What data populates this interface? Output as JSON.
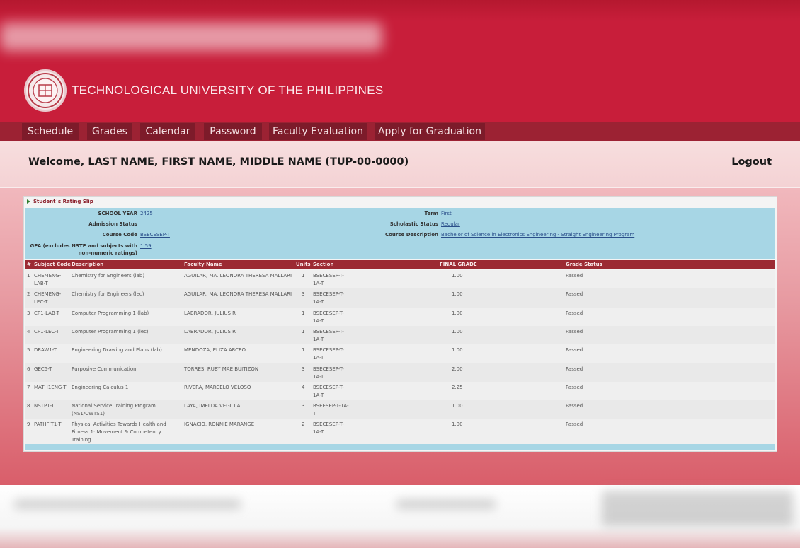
{
  "header": {
    "university_name": "TECHNOLOGICAL UNIVERSITY OF THE PHILIPPINES",
    "logo_icon": "university-seal-icon"
  },
  "nav": {
    "items": [
      "Schedule",
      "Grades",
      "Calendar",
      "Password",
      "Faculty Evaluation",
      "Apply for Graduation"
    ]
  },
  "welcome": {
    "text": "Welcome, LAST NAME, FIRST NAME, MIDDLE NAME (TUP-00-0000)",
    "logout": "Logout"
  },
  "rating_slip": {
    "title": "Student`s Rating Slip",
    "school_year_label": "SCHOOL YEAR",
    "school_year": "2425",
    "term_label": "Term",
    "term": "First",
    "admission_status_label": "Admission Status",
    "scholastic_status_label": "Scholastic Status",
    "scholastic_status": "Regular",
    "course_code_label": "Course Code",
    "course_code": "BSECESEP-T",
    "course_description_label": "Course Description",
    "course_description": "Bachelor of Science in Electronics Engineering - Straight Engineering Program",
    "gpa_label_1": "GPA (excludes NSTP and subjects with",
    "gpa_label_2": "non-numeric ratings)",
    "gpa": "1.59",
    "columns": [
      "#",
      "Subject Code",
      "Description",
      "Faculty Name",
      "Units",
      "Section",
      "FINAL GRADE",
      "Grade Status"
    ],
    "rows": [
      {
        "num": "1",
        "code": "CHEMENG-LAB-T",
        "desc": "Chemistry for Engineers (lab)",
        "faculty": "AGUILAR, MA. LEONORA THERESA MALLARI",
        "units": "1",
        "section": "BSECESEP-T-1A-T",
        "grade": "1.00",
        "status": "Passed"
      },
      {
        "num": "2",
        "code": "CHEMENG-LEC-T",
        "desc": "Chemistry for Engineers (lec)",
        "faculty": "AGUILAR, MA. LEONORA THERESA MALLARI",
        "units": "3",
        "section": "BSECESEP-T-1A-T",
        "grade": "1.00",
        "status": "Passed"
      },
      {
        "num": "3",
        "code": "CP1-LAB-T",
        "desc": "Computer Programming 1 (lab)",
        "faculty": "LABRADOR, JULIUS R",
        "units": "1",
        "section": "BSECESEP-T-1A-T",
        "grade": "1.00",
        "status": "Passed"
      },
      {
        "num": "4",
        "code": "CP1-LEC-T",
        "desc": "Computer Programming 1 (lec)",
        "faculty": "LABRADOR, JULIUS R",
        "units": "1",
        "section": "BSECESEP-T-1A-T",
        "grade": "1.00",
        "status": "Passed"
      },
      {
        "num": "5",
        "code": "DRAW1-T",
        "desc": "Engineering Drawing and Plans (lab)",
        "faculty": "MENDOZA, ELIZA ARCEO",
        "units": "1",
        "section": "BSECESEP-T-1A-T",
        "grade": "1.00",
        "status": "Passed"
      },
      {
        "num": "6",
        "code": "GEC5-T",
        "desc": "Purposive Communication",
        "faculty": "TORRES, RUBY MAE BUITIZON",
        "units": "3",
        "section": "BSECESEP-T-1A-T",
        "grade": "2.00",
        "status": "Passed"
      },
      {
        "num": "7",
        "code": "MATH1ENG-T",
        "desc": "Engineering Calculus 1",
        "faculty": "RIVERA, MARCELO VELOSO",
        "units": "4",
        "section": "BSECESEP-T-1A-T",
        "grade": "2.25",
        "status": "Passed"
      },
      {
        "num": "8",
        "code": "NSTP1-T",
        "desc": "National Service Training Program 1 (NS1/CWTS1)",
        "faculty": "LAYA, IMELDA VEGILLA",
        "units": "3",
        "section": "BSEESEP-T-1A-T",
        "grade": "1.00",
        "status": "Passed"
      },
      {
        "num": "9",
        "code": "PATHFIT1-T",
        "desc": "Physical Activities Towards Health and Fitness 1: Movement & Competency Training",
        "faculty": "IGNACIO, RONNIE MARAÑGE",
        "units": "2",
        "section": "BSECESEP-T-1A-T",
        "grade": "1.00",
        "status": "Passed"
      }
    ]
  }
}
